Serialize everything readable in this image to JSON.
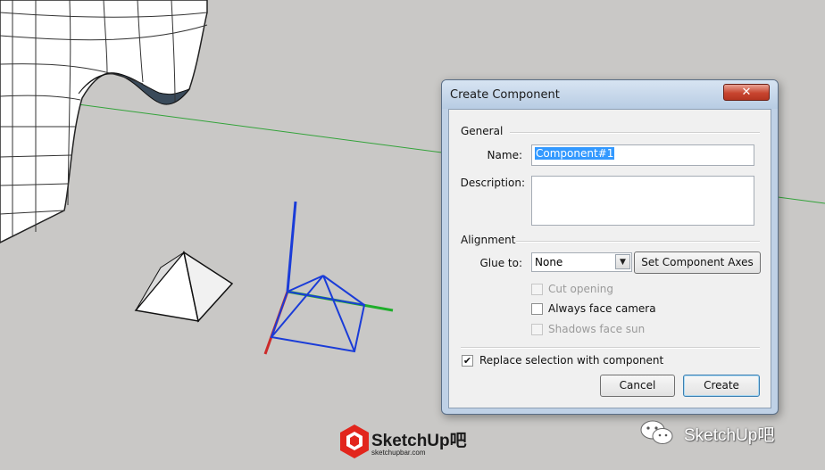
{
  "dialog": {
    "title": "Create Component",
    "close_symbol": "✕",
    "general_label": "General",
    "name_label": "Name:",
    "name_value": "Component#1",
    "description_label": "Description:",
    "description_value": "",
    "alignment_label": "Alignment",
    "glue_to_label": "Glue to:",
    "glue_to_value": "None",
    "set_axes_button": "Set Component Axes",
    "cut_opening": {
      "label": "Cut opening",
      "checked": false,
      "enabled": false
    },
    "always_face_camera": {
      "label": "Always face camera",
      "checked": false,
      "enabled": true
    },
    "shadows_face_sun": {
      "label": "Shadows face sun",
      "checked": false,
      "enabled": false
    },
    "replace_selection": {
      "label": "Replace selection with component",
      "checked": true,
      "enabled": true
    },
    "cancel_button": "Cancel",
    "create_button": "Create"
  },
  "watermark": {
    "brand": "SketchUp吧",
    "url": "sketchupbar.com",
    "social_text": "SketchUp吧"
  },
  "colors": {
    "axis_red": "#cc2a2a",
    "axis_green": "#1fae2b",
    "axis_blue": "#1a3cd8",
    "background": "#c9c8c6"
  }
}
